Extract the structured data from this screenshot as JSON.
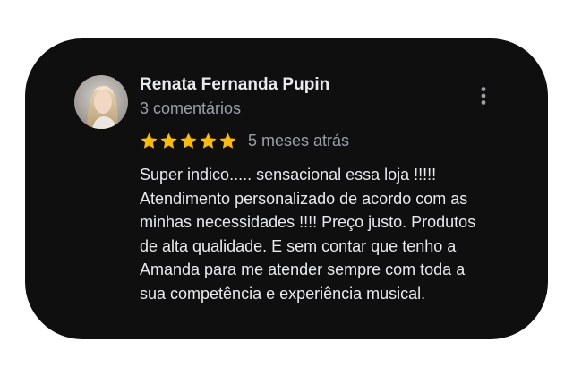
{
  "review": {
    "author_name": "Renata Fernanda Pupin",
    "author_meta": "3 comentários",
    "rating": 5,
    "rating_max": 5,
    "time_ago": "5 meses atrás",
    "text_lines": [
      "Super indico..... sensacional essa loja !!!!!",
      "Atendimento personalizado de acordo com as",
      "minhas necessidades !!!! Preço justo. Produtos",
      "de alta qualidade. E sem contar que tenho a",
      "Amanda para me atender sempre com toda a",
      "sua competência e experiência musical."
    ]
  },
  "icons": {
    "more": "more-vert-icon",
    "star": "star-icon",
    "avatar": "avatar-photo"
  },
  "colors": {
    "card_background": "#0f0f0f",
    "star": "#fbbc04",
    "primary_text": "#e8eaed",
    "secondary_text": "#9aa0a6"
  }
}
